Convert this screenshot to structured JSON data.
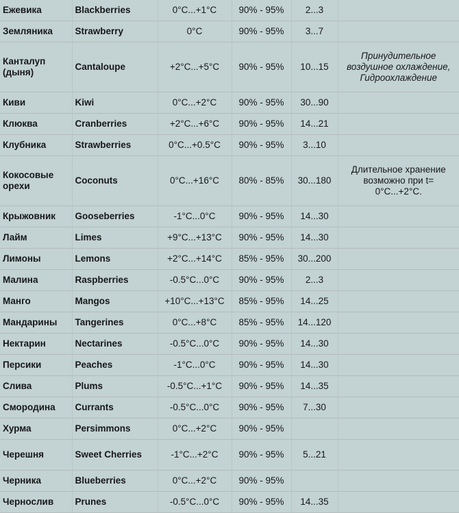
{
  "table": {
    "name": "fruit-storage-conditions-table",
    "columns": [
      {
        "key": "ru",
        "name": "produce-name-russian"
      },
      {
        "key": "en",
        "name": "produce-name-english"
      },
      {
        "key": "temp",
        "name": "storage-temperature"
      },
      {
        "key": "hum",
        "name": "relative-humidity"
      },
      {
        "key": "life",
        "name": "shelf-life-days"
      },
      {
        "key": "note",
        "name": "storage-note"
      }
    ],
    "rows": [
      {
        "ru": "Ежевика",
        "en": "Blackberries",
        "temp": "0°C...+1°C",
        "hum": "90% - 95%",
        "life": "2...3",
        "note": "",
        "note_italic": false,
        "size": "std"
      },
      {
        "ru": "Земляника",
        "en": "Strawberry",
        "temp": "0°C",
        "hum": "90% - 95%",
        "life": "3...7",
        "note": "",
        "note_italic": false,
        "size": "std"
      },
      {
        "ru": "Канталуп (дыня)",
        "en": "Cantaloupe",
        "temp": "+2°C...+5°C",
        "hum": "90% - 95%",
        "life": "10...15",
        "note": "Принудительное воздушное охлаждение, Гидроохлаждение",
        "note_italic": true,
        "size": "tall"
      },
      {
        "ru": "Киви",
        "en": "Kiwi",
        "temp": "0°C...+2°C",
        "hum": "90% - 95%",
        "life": "30...90",
        "note": "",
        "note_italic": false,
        "size": "std"
      },
      {
        "ru": "Клюква",
        "en": "Cranberries",
        "temp": "+2°C...+6°C",
        "hum": "90% - 95%",
        "life": "14...21",
        "note": "",
        "note_italic": false,
        "size": "std"
      },
      {
        "ru": "Клубника",
        "en": "Strawberries",
        "temp": "0°C...+0.5°C",
        "hum": "90% - 95%",
        "life": "3...10",
        "note": "",
        "note_italic": false,
        "size": "std"
      },
      {
        "ru": "Кокосовые орехи",
        "en": "Coconuts",
        "temp": "0°C...+16°C",
        "hum": "80% - 85%",
        "life": "30...180",
        "note": "Длительное хранение возможно при t= 0°C...+2°C.",
        "note_italic": false,
        "size": "tall"
      },
      {
        "ru": "Крыжовник",
        "en": "Gooseberries",
        "temp": "-1°C...0°C",
        "hum": "90% - 95%",
        "life": "14...30",
        "note": "",
        "note_italic": false,
        "size": "std"
      },
      {
        "ru": "Лайм",
        "en": "Limes",
        "temp": "+9°C...+13°C",
        "hum": "90% - 95%",
        "life": "14...30",
        "note": "",
        "note_italic": false,
        "size": "std"
      },
      {
        "ru": "Лимоны",
        "en": "Lemons",
        "temp": "+2°C...+14°C",
        "hum": "85% - 95%",
        "life": "30...200",
        "note": "",
        "note_italic": false,
        "size": "std"
      },
      {
        "ru": "Малина",
        "en": "Raspberries",
        "temp": "-0.5°C...0°C",
        "hum": "90% - 95%",
        "life": "2...3",
        "note": "",
        "note_italic": false,
        "size": "std"
      },
      {
        "ru": "Манго",
        "en": "Mangos",
        "temp": "+10°C...+13°C",
        "hum": "85% - 95%",
        "life": "14...25",
        "note": "",
        "note_italic": false,
        "size": "std"
      },
      {
        "ru": "Мандарины",
        "en": "Tangerines",
        "temp": "0°C...+8°C",
        "hum": "85% - 95%",
        "life": "14...120",
        "note": "",
        "note_italic": false,
        "size": "std"
      },
      {
        "ru": "Нектарин",
        "en": "Nectarines",
        "temp": "-0.5°C...0°C",
        "hum": "90% - 95%",
        "life": "14...30",
        "note": "",
        "note_italic": false,
        "size": "std"
      },
      {
        "ru": "Персики",
        "en": "Peaches",
        "temp": "-1°C...0°C",
        "hum": "90% - 95%",
        "life": "14...30",
        "note": "",
        "note_italic": false,
        "size": "std"
      },
      {
        "ru": "Слива",
        "en": "Plums",
        "temp": "-0.5°C...+1°C",
        "hum": "90% - 95%",
        "life": "14...35",
        "note": "",
        "note_italic": false,
        "size": "std"
      },
      {
        "ru": "Смородина",
        "en": "Currants",
        "temp": "-0.5°C...0°C",
        "hum": "90% - 95%",
        "life": "7...30",
        "note": "",
        "note_italic": false,
        "size": "std"
      },
      {
        "ru": "Хурма",
        "en": "Persimmons",
        "temp": "0°C...+2°C",
        "hum": "90% - 95%",
        "life": "",
        "note": "",
        "note_italic": false,
        "size": "std"
      },
      {
        "ru": "Черешня",
        "en": "Sweet Cherries",
        "temp": "-1°C...+2°C",
        "hum": "90% - 95%",
        "life": "5...21",
        "note": "",
        "note_italic": false,
        "size": "mid"
      },
      {
        "ru": "Черника",
        "en": "Blueberries",
        "temp": "0°C...+2°C",
        "hum": "90% - 95%",
        "life": "",
        "note": "",
        "note_italic": false,
        "size": "std"
      },
      {
        "ru": "Чернослив",
        "en": "Prunes",
        "temp": "-0.5°C...0°C",
        "hum": "90% - 95%",
        "life": "14...35",
        "note": "",
        "note_italic": false,
        "size": "std"
      }
    ]
  },
  "colors": {
    "background": "#c3d2d2",
    "grid_line": "#b4bcbe",
    "text": "#16181a"
  }
}
